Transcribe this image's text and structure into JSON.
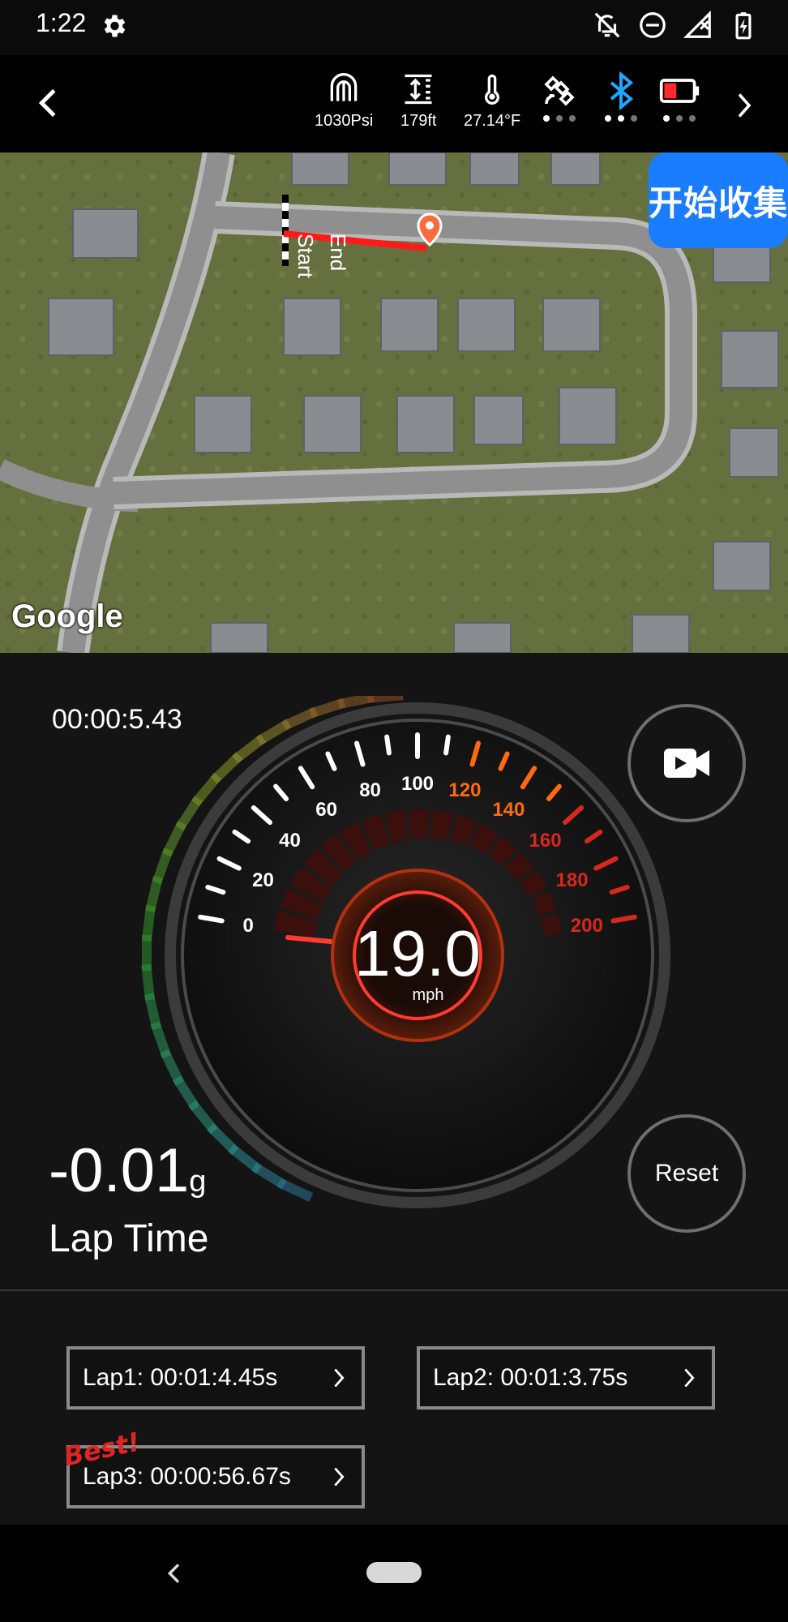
{
  "status_bar": {
    "time": "1:22",
    "icons": [
      "settings-gear-icon",
      "notifications-off-icon",
      "do-not-disturb-icon",
      "signal-icon",
      "battery-charging-icon"
    ]
  },
  "top_bar": {
    "sensors": [
      {
        "icon": "pressure-icon",
        "value": "1030Psi"
      },
      {
        "icon": "altitude-icon",
        "value": "179ft"
      },
      {
        "icon": "thermometer-icon",
        "value": "27.14°F"
      }
    ],
    "satellite_dots_active": 1,
    "bluetooth_dots_active": 2,
    "battery_dots_active": 1,
    "colors": {
      "bluetooth": "#1ea7ff",
      "battery_low": "#ff2a2a"
    }
  },
  "map": {
    "collect_button": "开始收集",
    "start_label": "Start",
    "end_label": "End",
    "attribution": "Google"
  },
  "dashboard": {
    "elapsed": "00:00:5.43",
    "speed": "19.0",
    "speed_unit": "mph",
    "speed_ticks": [
      "0",
      "20",
      "40",
      "60",
      "80",
      "100",
      "120",
      "140",
      "160",
      "180",
      "200"
    ],
    "g_value": "-0.01",
    "g_unit": "g",
    "lap_time_label": "Lap Time",
    "reset_label": "Reset",
    "colors": {
      "accent": "#e8541c",
      "needle": "#ff3b30",
      "high_ticks": "#ff6a10",
      "red_ticks": "#d8281c"
    }
  },
  "laps": [
    {
      "label": "Lap1: 00:01:4.45s"
    },
    {
      "label": "Lap2: 00:01:3.75s"
    },
    {
      "label": "Lap3: 00:00:56.67s"
    }
  ],
  "best_badge": "Best!"
}
